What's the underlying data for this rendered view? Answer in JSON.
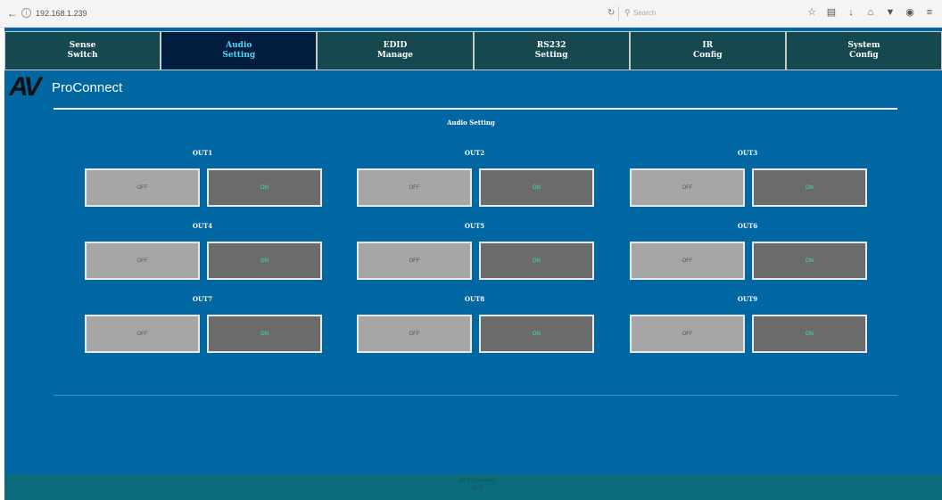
{
  "browser": {
    "url": "192.168.1.239",
    "search_placeholder": "Search"
  },
  "tabs": [
    {
      "line1": "Sense",
      "line2": "Switch"
    },
    {
      "line1": "Audio",
      "line2": "Setting"
    },
    {
      "line1": "EDID",
      "line2": "Manage"
    },
    {
      "line1": "RS232",
      "line2": "Setting"
    },
    {
      "line1": "IR",
      "line2": "Config"
    },
    {
      "line1": "System",
      "line2": "Config"
    }
  ],
  "logo": {
    "mark": "AV",
    "text": "ProConnect"
  },
  "section_title": "Audio Setting",
  "outputs": [
    {
      "label": "OUT1",
      "off": "OFF",
      "on": "ON"
    },
    {
      "label": "OUT2",
      "off": "OFF",
      "on": "ON"
    },
    {
      "label": "OUT3",
      "off": "OFF",
      "on": "ON"
    },
    {
      "label": "OUT4",
      "off": "OFF",
      "on": "ON"
    },
    {
      "label": "OUT5",
      "off": "OFF",
      "on": "ON"
    },
    {
      "label": "OUT6",
      "off": "OFF",
      "on": "ON"
    },
    {
      "label": "OUT7",
      "off": "OFF",
      "on": "ON"
    },
    {
      "label": "OUT8",
      "off": "OFF",
      "on": "ON"
    },
    {
      "label": "OUT9",
      "off": "OFF",
      "on": "ON"
    }
  ],
  "footer": {
    "line1": "AV ProConnect",
    "line2": "v1.0"
  },
  "colors": {
    "background": "#0067a3",
    "tab": "#16494f",
    "tab_active": "#001c3f",
    "tab_active_text": "#4fd8f5",
    "button_off": "#a6a6a6",
    "button_on": "#6b6b6b",
    "on_text": "#39e0c8",
    "footer": "#0c6c7c"
  }
}
